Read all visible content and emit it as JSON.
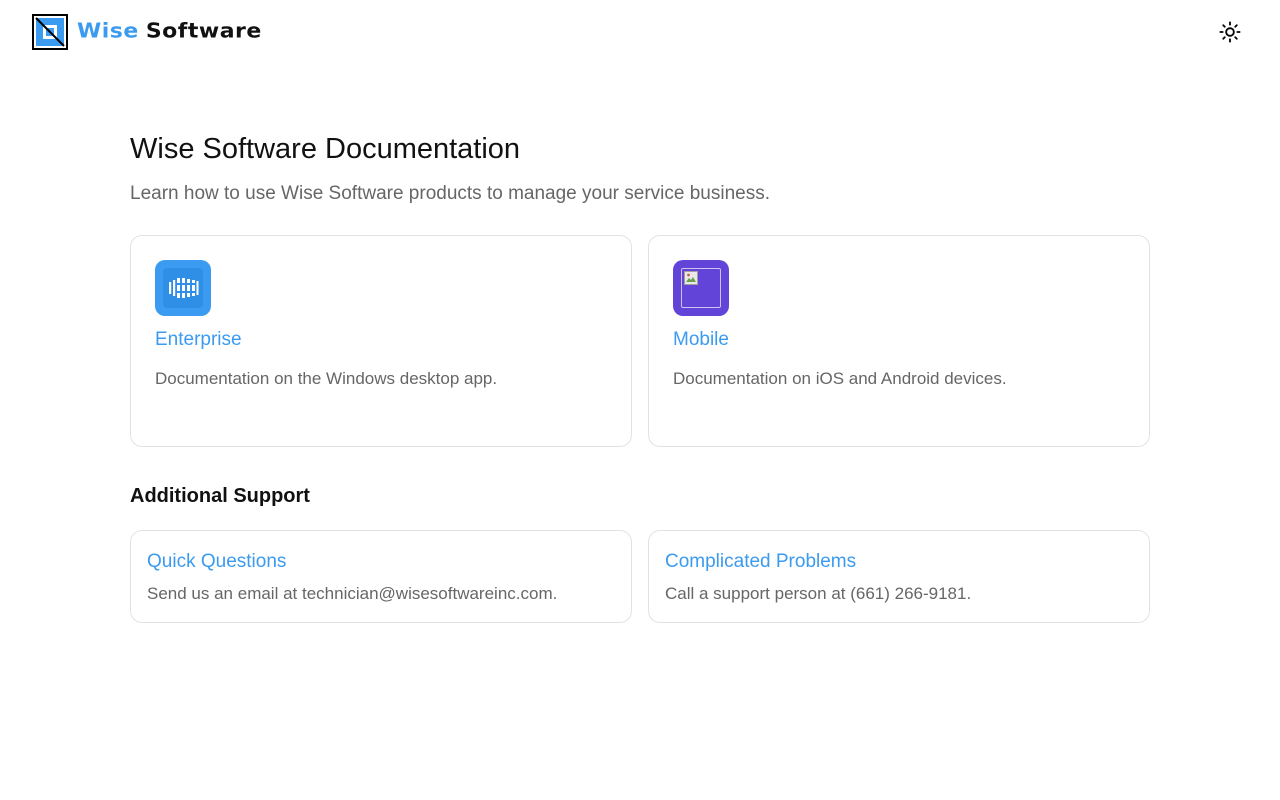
{
  "header": {
    "brand_wise": "Wise",
    "brand_software": "Software",
    "theme_icon": "sun-icon"
  },
  "main": {
    "title": "Wise Software Documentation",
    "subtitle": "Learn how to use Wise Software products to manage your service business."
  },
  "cards": [
    {
      "title": "Enterprise",
      "description": "Documentation on the Windows desktop app.",
      "icon": "enterprise-app-icon",
      "icon_bg": "#3b9bf0"
    },
    {
      "title": "Mobile",
      "description": "Documentation on iOS and Android devices.",
      "icon": "broken-image-icon",
      "icon_bg": "#6244d8"
    }
  ],
  "additional_support": {
    "heading": "Additional Support",
    "items": [
      {
        "title": "Quick Questions",
        "description": "Send us an email at technician@wisesoftwareinc.com."
      },
      {
        "title": "Complicated Problems",
        "description": "Call a support person at (661) 266-9181."
      }
    ]
  },
  "colors": {
    "accent": "#3b9bf0",
    "purple": "#6244d8",
    "muted_text": "#666666",
    "border": "#e2e2e2"
  }
}
